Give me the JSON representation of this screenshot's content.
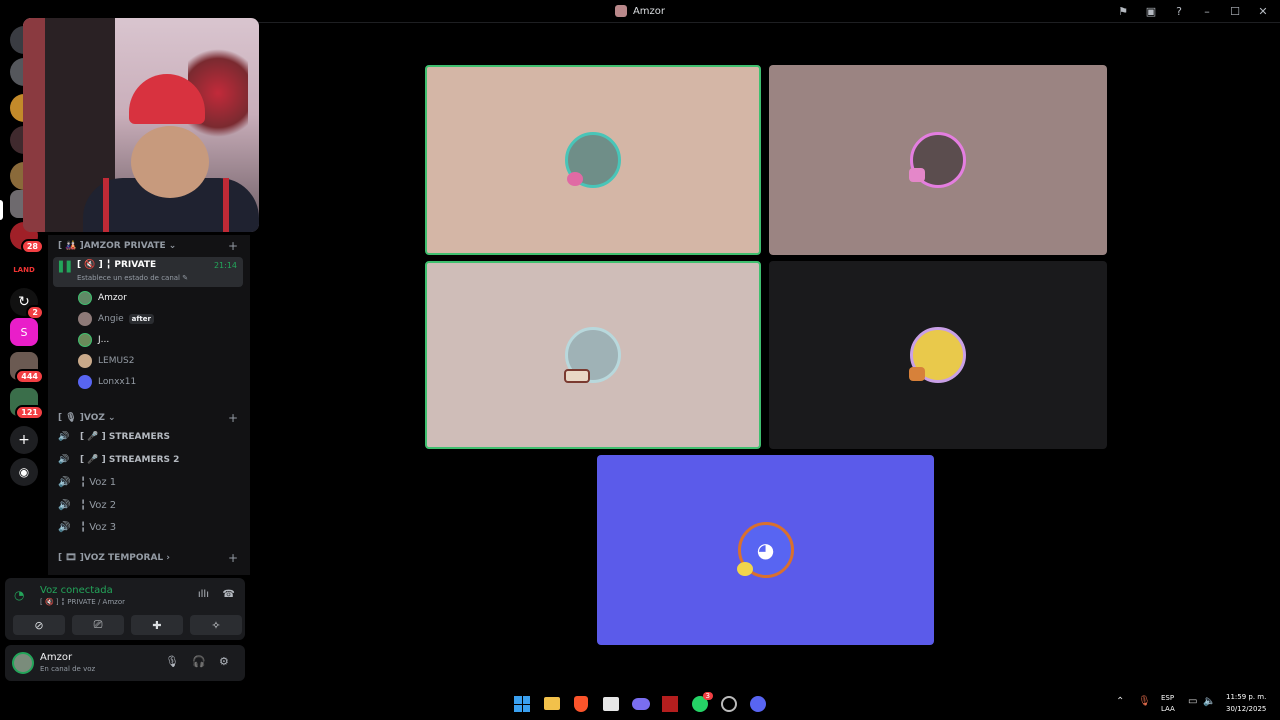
{
  "window": {
    "title": "Amzor"
  },
  "servers": {
    "badges": [
      "28",
      "2",
      "444",
      "121"
    ],
    "letter_server": "S"
  },
  "sidebar": {
    "category_private": "[ 🎎 ]AMZOR PRIVATE ⌄",
    "active_channel": {
      "name": "[ 🔇 ] ╏ PRIVATE",
      "time": "21:14",
      "status": "Establece un estado de canal ✎"
    },
    "members": [
      {
        "name": "Amzor",
        "tag": ""
      },
      {
        "name": "Angie",
        "tag": "after"
      },
      {
        "name": "J...",
        "tag": ""
      },
      {
        "name": "LEMUS2",
        "tag": ""
      },
      {
        "name": "Lonxx11",
        "tag": ""
      }
    ],
    "category_voz": "[ 🎙 ]VOZ ⌄",
    "voice_channels": [
      "[ 🎤 ] STREAMERS",
      "[ 🎤 ] STREAMERS 2",
      "╏ Voz 1",
      "╏ Voz 2",
      "╏ Voz 3"
    ],
    "category_temporal": "[ 🎞 ]VOZ TEMPORAL ›"
  },
  "voice_panel": {
    "title": "Voz conectada",
    "subtitle": "[ 🔇 ] ╏ PRIVATE / Amzor"
  },
  "user_panel": {
    "name": "Amzor",
    "status": "En canal de voz"
  },
  "taskbar": {
    "lang": "ESP",
    "layout": "LAA",
    "time": "11:59 p. m.",
    "date": "30/12/2025",
    "whatsapp_badge": "3"
  },
  "colors": {
    "accent_green": "#23a55a",
    "blurple": "#5b5bea",
    "tile_1": "#d4b6a6",
    "tile_2": "#9b8482",
    "tile_3": "#cfbdb8",
    "tile_4": "#1a1a1c"
  }
}
